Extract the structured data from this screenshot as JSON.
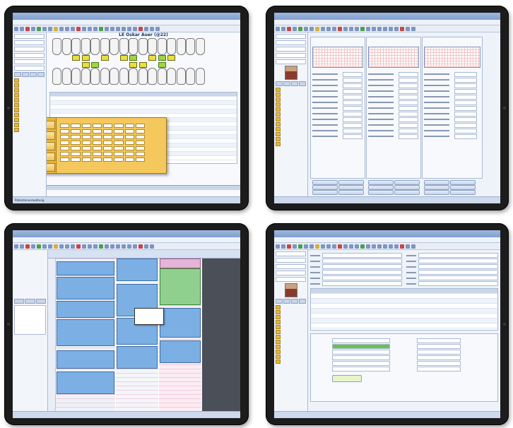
{
  "tablet1": {
    "patient_header": "LE Oskar Auer (@22)",
    "status_text": "Patientenverwaltung"
  },
  "colors": {
    "bezel": "#1c1c1c",
    "window_chrome": "#7f9fcf",
    "dialog": "#f4c85c",
    "appointment": "#7cb0e4",
    "appointment_alt": "#8fd08f",
    "marker_yellow": "#e7e042",
    "marker_green": "#9fd63f"
  },
  "icons": [
    "toolbar-icon",
    "folder-icon",
    "tooth-icon",
    "calendar-icon",
    "avatar-icon"
  ]
}
